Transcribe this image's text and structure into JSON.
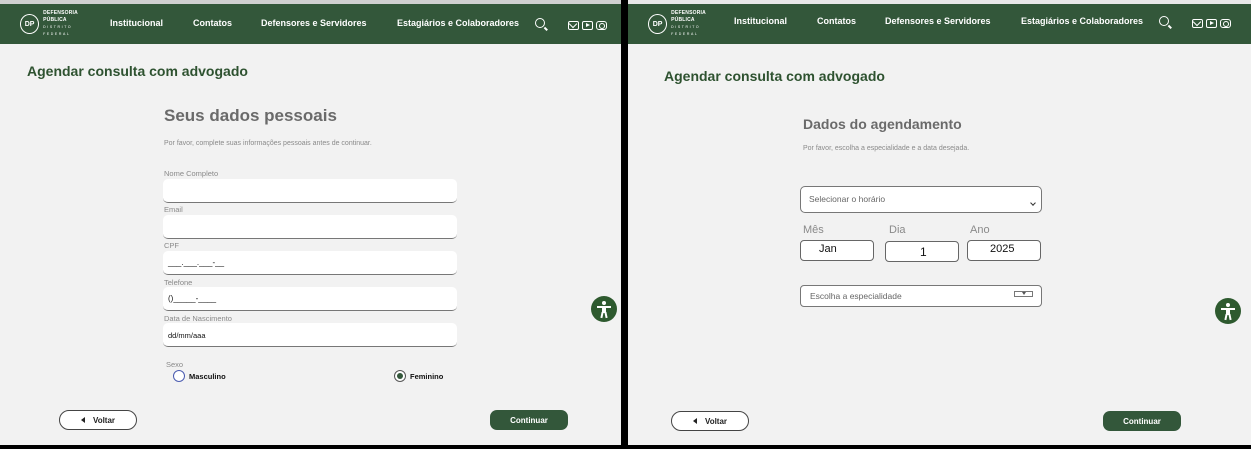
{
  "nav": {
    "logo_line1": "DEFENSORIA PÚBLICA",
    "logo_line2": "DISTRITO FEDERAL",
    "logo_seal": "DP",
    "items": [
      "Institucional",
      "Contatos",
      "Defensores e Servidores",
      "Estagiários e Colaboradores"
    ],
    "icons": [
      "search-icon",
      "mail-icon",
      "youtube-icon",
      "instagram-icon"
    ]
  },
  "page_title": "Agendar consulta com advogado",
  "personal": {
    "title": "Seus dados pessoais",
    "subtitle": "Por favor, complete suas informações pessoais antes de continuar.",
    "fields": [
      {
        "label": "Nome Completo",
        "value": ""
      },
      {
        "label": "Email",
        "value": ""
      },
      {
        "label": "CPF",
        "value": "___.___.___-__"
      },
      {
        "label": "Telefone",
        "value": "()_____-____"
      },
      {
        "label": "Data de Nascimento",
        "value": "dd/mm/aaa"
      }
    ],
    "sex_label": "Sexo",
    "sex_options": [
      "Masculino",
      "Feminino"
    ],
    "sex_selected": "Feminino"
  },
  "schedule": {
    "title": "Dados do agendamento",
    "subtitle": "Por favor, escolha a especialidade e a data desejada.",
    "time_placeholder": "Selecionar o horário",
    "date_labels": {
      "month": "Mês",
      "day": "Dia",
      "year": "Ano"
    },
    "date_values": {
      "month": "Jan",
      "day": "1",
      "year": "2025"
    },
    "specialty_placeholder": "Escolha a especialidade"
  },
  "buttons": {
    "back": "Voltar",
    "continue": "Continuar"
  },
  "colors": {
    "brand_green": "#33573a",
    "title_green": "#2e5230",
    "background": "#f2f2f2"
  }
}
